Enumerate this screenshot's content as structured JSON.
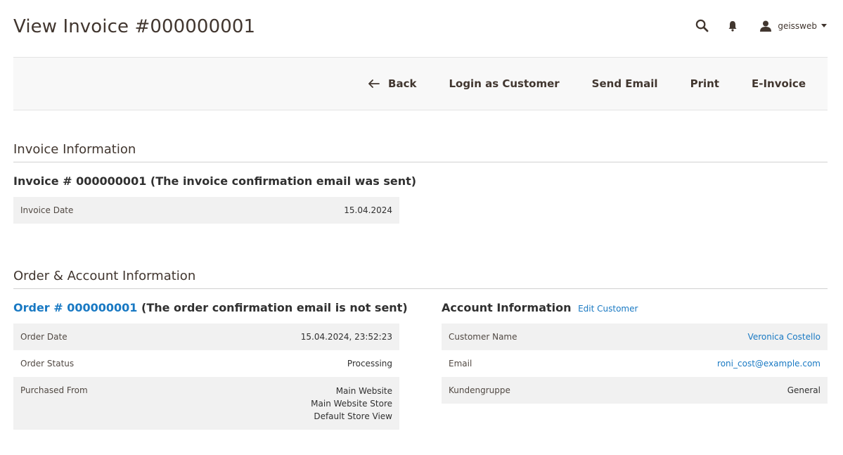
{
  "header": {
    "title": "View Invoice #000000001",
    "user_name": "geissweb",
    "icons": [
      "search-icon",
      "bell-icon",
      "user-icon",
      "caret-down-icon"
    ]
  },
  "action_bar": {
    "back_label": "Back",
    "login_as_customer_label": "Login as Customer",
    "send_email_label": "Send Email",
    "print_label": "Print",
    "e_invoice_label": "E-Invoice"
  },
  "invoice_info": {
    "section_title": "Invoice Information",
    "invoice_title": "Invoice # 000000001 (The invoice confirmation email was sent)",
    "rows": [
      {
        "label": "Invoice Date",
        "value": "15.04.2024"
      }
    ]
  },
  "order_account": {
    "section_title": "Order & Account Information",
    "order": {
      "title_link": "Order # 000000001",
      "title_suffix": "(The order confirmation email is not sent)",
      "rows": [
        {
          "label": "Order Date",
          "value": "15.04.2024, 23:52:23"
        },
        {
          "label": "Order Status",
          "value": "Processing"
        },
        {
          "label": "Purchased From",
          "values": [
            "Main Website",
            "Main Website Store",
            "Default Store View"
          ]
        }
      ]
    },
    "account": {
      "title": "Account Information",
      "edit_link": "Edit Customer",
      "rows": [
        {
          "label": "Customer Name",
          "value": "Veronica Costello"
        },
        {
          "label": "Email",
          "value": "roni_cost@example.com"
        },
        {
          "label": "Kundengruppe",
          "value": "General"
        }
      ]
    }
  },
  "colors": {
    "link": "#1979c3",
    "title_text": "#41362f",
    "row_stripe": "#f1f1f1",
    "action_bar_bg": "#f8f8f8"
  }
}
